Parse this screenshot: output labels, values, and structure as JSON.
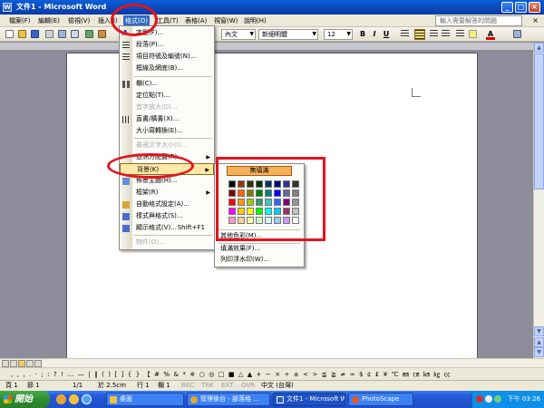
{
  "window": {
    "title": "文件1 - Microsoft Word",
    "icon": "word-icon",
    "minimize": "_",
    "maximize": "□",
    "close": "×"
  },
  "menubar": {
    "items": [
      "檔案(F)",
      "編輯(E)",
      "檢視(V)",
      "插入(I)",
      "格式(O)",
      "工具(T)",
      "表格(A)",
      "視窗(W)",
      "說明(H)"
    ],
    "help_box": "輸入需要解答的問題",
    "close_x": "×"
  },
  "toolbar": {
    "style": "內文",
    "font": "新細明體",
    "size": "12",
    "bold": "B",
    "italic": "I",
    "underline": "U",
    "font_color": "A"
  },
  "format_menu": {
    "items": [
      {
        "label": "字型(F)...",
        "icon": "font-icon",
        "disabled": false
      },
      {
        "label": "段落(P)...",
        "icon": "paragraph-icon",
        "disabled": false
      },
      {
        "label": "項目符號及編號(N)...",
        "icon": "bullets-icon",
        "disabled": false
      },
      {
        "label": "框線及網底(B)...",
        "icon": "borders-icon",
        "disabled": false
      },
      {
        "label": "欄(C)...",
        "icon": "columns-icon",
        "disabled": false
      },
      {
        "label": "定位點(T)...",
        "icon": "",
        "disabled": false
      },
      {
        "label": "首字放大(D)...",
        "icon": "",
        "disabled": true
      },
      {
        "label": "直書/橫書(X)...",
        "icon": "text-direction-icon",
        "disabled": false
      },
      {
        "label": "大小寫轉換(E)...",
        "icon": "",
        "disabled": false
      },
      {
        "label": "最適文字大小(I)...",
        "icon": "",
        "disabled": true
      },
      {
        "label": "亞洲方配置(R)",
        "icon": "",
        "disabled": false,
        "submenu": true
      },
      {
        "label": "背景(K)",
        "icon": "",
        "disabled": false,
        "submenu": true,
        "highlighted": true
      },
      {
        "label": "佈景主題(H)...",
        "icon": "theme-icon",
        "disabled": false
      },
      {
        "label": "框架(R)",
        "icon": "",
        "disabled": false,
        "submenu": true
      },
      {
        "label": "自動格式設定(A)...",
        "icon": "autoformat-icon",
        "disabled": false
      },
      {
        "label": "樣式與格式(S)...",
        "icon": "styles-icon",
        "disabled": false
      },
      {
        "label": "顯示格式(V)...",
        "icon": "reveal-formatting-icon",
        "disabled": false,
        "shortcut": "Shift+F1"
      },
      {
        "label": "物件(O)...",
        "icon": "",
        "disabled": true
      }
    ]
  },
  "background_submenu": {
    "no_fill": "無填滿",
    "more_colors": "其他色彩(M)...",
    "fill_effects": "填滿效果(F)...",
    "watermark": "列印浮水印(W)...",
    "colors": [
      "#000000",
      "#993300",
      "#333300",
      "#003300",
      "#003366",
      "#000080",
      "#333399",
      "#333333",
      "#800000",
      "#FF6600",
      "#808000",
      "#008000",
      "#008080",
      "#0000FF",
      "#666699",
      "#808080",
      "#FF0000",
      "#FF9900",
      "#99CC00",
      "#339966",
      "#33CCCC",
      "#3366FF",
      "#800080",
      "#969696",
      "#FF00FF",
      "#FFCC00",
      "#FFFF00",
      "#00FF00",
      "#00FFFF",
      "#00CCFF",
      "#993366",
      "#C0C0C0",
      "#FF99CC",
      "#FFCC99",
      "#FFFF99",
      "#CCFFCC",
      "#CCFFFF",
      "#99CCFF",
      "#CC99FF",
      "#FFFFFF"
    ]
  },
  "symbol_bar": {
    "symbols": ",  ,  ,  .  ·  ;  :  ?  !  …  —  |  ‖  (  )  [  ]  {  }  【  #  %  &  *  ※  ○  ◎  □  ■  △  ▲  +  −  ×  ÷  ±  <  >  ≦  ≧  ≠  ∞  $  ¢  £  ¥  ℃  ㎜  ㎝  ㎞  ㎏  ㏄"
  },
  "statusbar": {
    "page": "頁 1",
    "section": "節 1",
    "pages": "1/1",
    "at": "於 2.5cm",
    "line": "行 1",
    "col": "欄 1",
    "rec": "REC",
    "trk": "TRK",
    "ext": "EXT",
    "ovr": "OVR",
    "lang": "中文 (台灣)"
  },
  "taskbar": {
    "start": "開始",
    "buttons": [
      {
        "label": "桌面",
        "active": false
      },
      {
        "label": "管理後台 - 部落格 ...",
        "active": false
      },
      {
        "label": "文件1 - Microsoft W...",
        "active": true
      },
      {
        "label": "PhotoScape",
        "active": false
      }
    ],
    "clock": "下午 03:26"
  },
  "colors": {
    "annotation_red": "#e3141e",
    "highlight_orange": "#f7b05a",
    "menu_highlight": "#ffe8a6"
  }
}
